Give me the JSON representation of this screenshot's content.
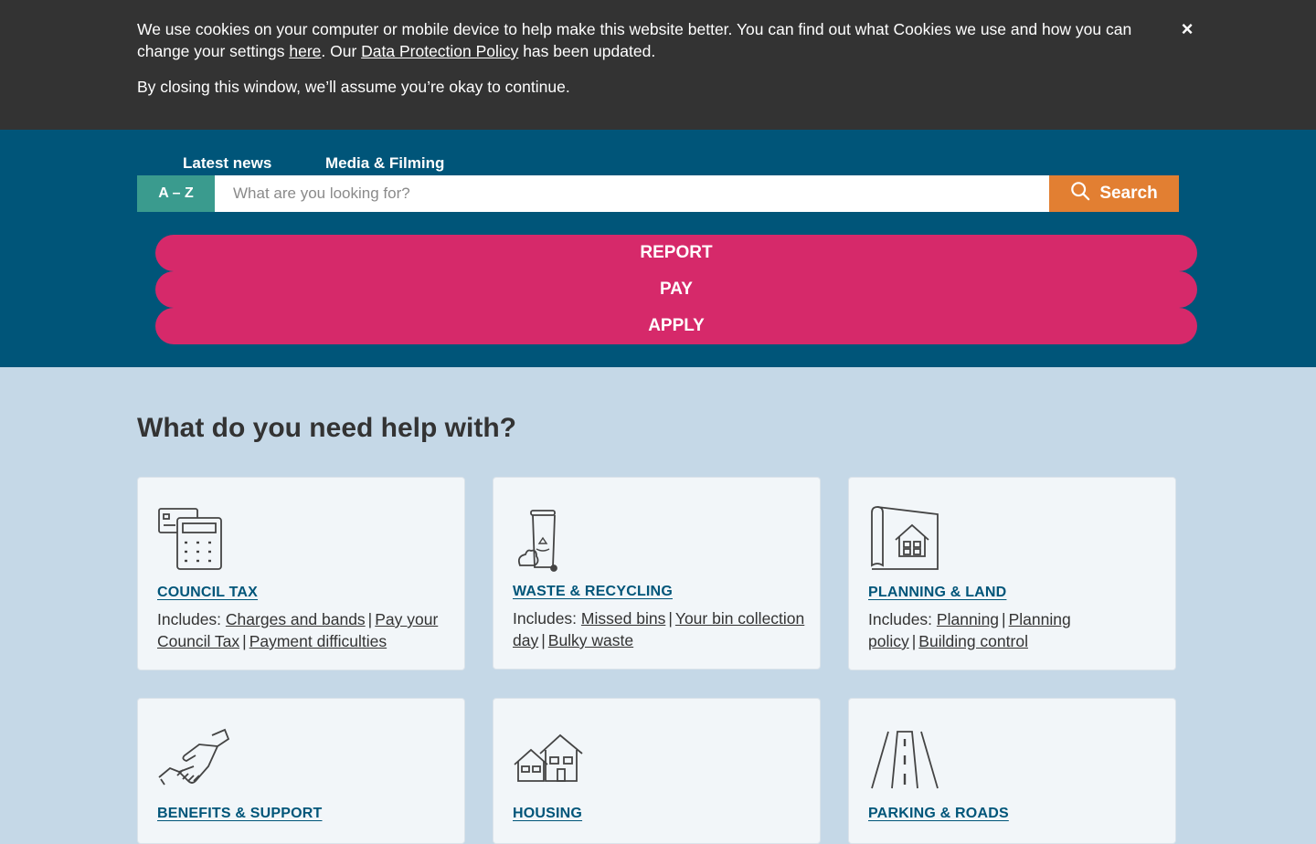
{
  "cookie": {
    "line1_part1": "We use cookies on your computer or mobile device to help make this website better. You can find out what Cookies we use and how you can change your settings ",
    "here_link": "here",
    "line1_part2": ". Our ",
    "policy_link": "Data Protection Policy",
    "line1_part3": " has been updated.",
    "line2": "By closing this window, we’ll assume you’re okay to continue.",
    "close_label": "×"
  },
  "header": {
    "nav": [
      "Latest news",
      "Media & Filming"
    ],
    "az_label": "A – Z",
    "search_placeholder": "What are you looking for?",
    "search_label": "Search",
    "actions": [
      "REPORT",
      "PAY",
      "APPLY"
    ]
  },
  "main": {
    "title": "What do you need help with?",
    "includes_label": "Includes:",
    "cards": [
      {
        "title": "COUNCIL TAX",
        "icon": "calculator-icon",
        "links": [
          "Charges and bands",
          "Pay your Council Tax",
          "Payment difficulties"
        ]
      },
      {
        "title": "WASTE & RECYCLING",
        "icon": "recycling-bin-icon",
        "links": [
          "Missed bins",
          "Your bin collection day",
          "Bulky waste"
        ]
      },
      {
        "title": "PLANNING & LAND",
        "icon": "blueprint-house-icon",
        "links": [
          "Planning",
          "Planning policy",
          "Building control"
        ]
      },
      {
        "title": "BENEFITS & SUPPORT",
        "icon": "handshake-icon",
        "links": []
      },
      {
        "title": "HOUSING",
        "icon": "houses-icon",
        "links": []
      },
      {
        "title": "PARKING & ROADS",
        "icon": "road-icon",
        "links": []
      }
    ]
  },
  "colors": {
    "cookie_bg": "#333333",
    "header_bg": "#005579",
    "az_bg": "#3a9b8e",
    "search_bg": "#e27f32",
    "action_bg": "#d6296a",
    "page_bg": "#c5d8e7",
    "card_bg": "#f2f6f9",
    "link_blue": "#005579"
  }
}
